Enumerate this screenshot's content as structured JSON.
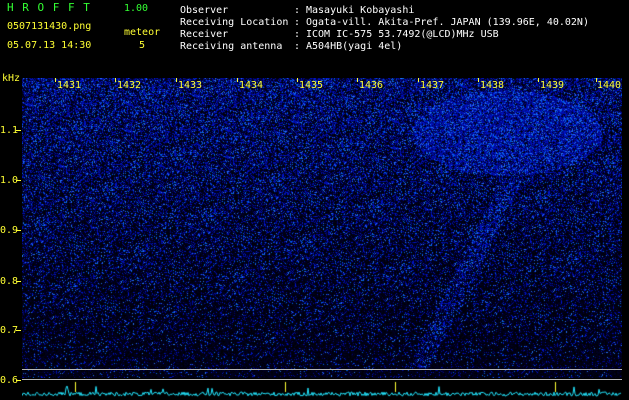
{
  "header": {
    "app_title": "H R O F F T",
    "version": "1.00",
    "filename": "0507131430.png",
    "meteor_label": "meteor",
    "meteor_count": "5",
    "datetime": "05.07.13 14:30"
  },
  "info": {
    "observer_label": "Observer",
    "observer_value": "Masayuki Kobayashi",
    "location_label": "Receiving Location",
    "location_value": "Ogata-vill. Akita-Pref. JAPAN (139.96E, 40.02N)",
    "receiver_label": "Receiver",
    "receiver_value": "ICOM IC-575 53.7492(@LCD)MHz USB",
    "antenna_label": "Receiving antenna",
    "antenna_value": "A504HB(yagi 4el)",
    "colon": ":"
  },
  "axes": {
    "y_unit": "kHz",
    "y_ticks": [
      "1.1",
      "1.0",
      "0.9",
      "0.8",
      "0.7",
      "0.6"
    ],
    "x_ticks": [
      "1431",
      "1432",
      "1433",
      "1434",
      "1435",
      "1436",
      "1437",
      "1438",
      "1439",
      "1440"
    ]
  },
  "colors": {
    "label_yellow": "#ffff33",
    "title_green": "#33ff33",
    "signal_blue": "#1a2cff",
    "amplitude_cyan": "#22e6ff"
  }
}
